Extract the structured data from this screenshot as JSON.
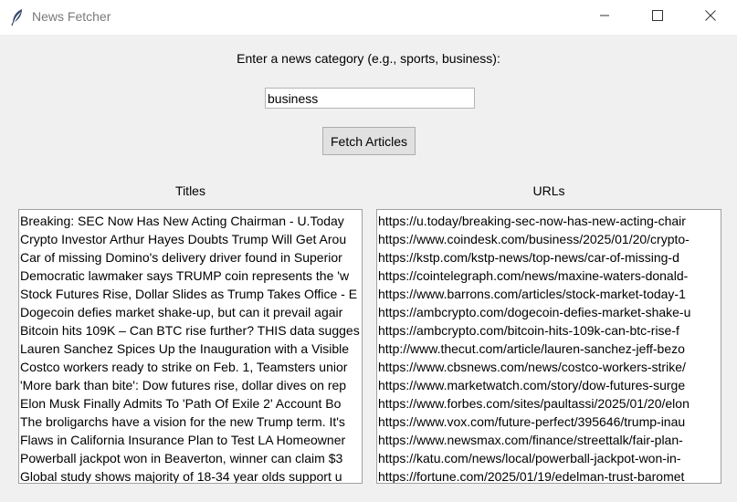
{
  "window": {
    "title": "News Fetcher"
  },
  "icons": {
    "app": "feather-icon",
    "minimize": "minimize-icon",
    "maximize": "maximize-icon",
    "close": "close-icon"
  },
  "form": {
    "prompt": "Enter a news category (e.g., sports, business):",
    "category_value": "business",
    "fetch_label": "Fetch Articles"
  },
  "columns": {
    "titles_label": "Titles",
    "urls_label": "URLs"
  },
  "titles": [
    "Breaking: SEC Now Has New Acting Chairman - U.Today",
    "Crypto Investor Arthur Hayes Doubts Trump Will Get Arou",
    "Car of missing Domino's delivery driver found in Superior",
    "Democratic lawmaker says TRUMP coin represents the 'w",
    "Stock Futures Rise, Dollar Slides as Trump Takes Office - E",
    "Dogecoin defies market shake-up, but can it prevail agair",
    "Bitcoin hits 109K – Can BTC rise further? THIS data sugges",
    "Lauren Sanchez Spices Up the Inauguration with a Visible",
    "Costco workers ready to strike on Feb. 1, Teamsters unior",
    "'More bark than bite': Dow futures rise, dollar dives on rep",
    "Elon Musk Finally Admits To 'Path Of Exile 2' Account Bo",
    "The broligarchs have a vision for the new Trump term. It's",
    "Flaws in California Insurance Plan to Test LA Homeowner",
    "Powerball jackpot won in Beaverton, winner can claim $3",
    "Global study shows majority of 18-34 year olds support u"
  ],
  "urls": [
    "https://u.today/breaking-sec-now-has-new-acting-chair",
    "https://www.coindesk.com/business/2025/01/20/crypto-",
    "https://kstp.com/kstp-news/top-news/car-of-missing-d",
    "https://cointelegraph.com/news/maxine-waters-donald-",
    "https://www.barrons.com/articles/stock-market-today-1",
    "https://ambcrypto.com/dogecoin-defies-market-shake-u",
    "https://ambcrypto.com/bitcoin-hits-109k-can-btc-rise-f",
    "http://www.thecut.com/article/lauren-sanchez-jeff-bezo",
    "https://www.cbsnews.com/news/costco-workers-strike/",
    "https://www.marketwatch.com/story/dow-futures-surge",
    "https://www.forbes.com/sites/paultassi/2025/01/20/elon",
    "https://www.vox.com/future-perfect/395646/trump-inau",
    "https://www.newsmax.com/finance/streettalk/fair-plan-",
    "https://katu.com/news/local/powerball-jackpot-won-in-",
    "https://fortune.com/2025/01/19/edelman-trust-baromet"
  ]
}
